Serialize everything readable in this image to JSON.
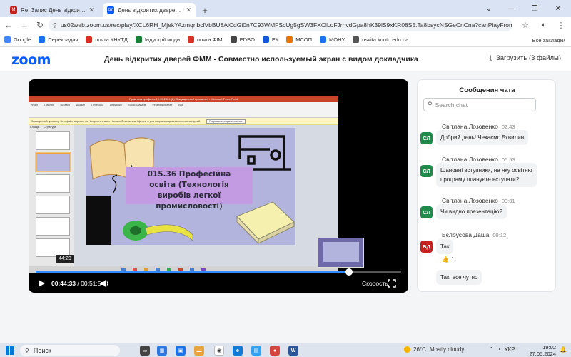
{
  "browser": {
    "tabs": [
      {
        "title": "Re: Запис День відкритих двер",
        "icon_color": "#c5221f",
        "active": false
      },
      {
        "title": "День відкритих дверей ФММ",
        "icon_color": "#0b5cff",
        "active": true
      }
    ],
    "new_tab_symbol": "+",
    "url": "us02web.zoom.us/rec/play/XCL6RH_MjekYAzmqnbclVbBU8AiCdGi0n7C93WMFScUg5gSW3FXClLoFJrnvdGpa8hK39lS9xKR08S5.Ta8bsycNSGeCnCna?canPlayFromShare=true&from...",
    "bookmarks": [
      {
        "label": "Google",
        "icon_color": "#4285f4"
      },
      {
        "label": "Перекладач",
        "icon_color": "#1a73e8"
      },
      {
        "label": "почта КНУТД",
        "icon_color": "#d93025"
      },
      {
        "label": "Індустрії моди",
        "icon_color": "#188038"
      },
      {
        "label": "почта ФІМ",
        "icon_color": "#d93025"
      },
      {
        "label": "EDBO",
        "icon_color": "#444444"
      },
      {
        "label": "ЕК",
        "icon_color": "#1558d6"
      },
      {
        "label": "МСОП",
        "icon_color": "#e37400"
      },
      {
        "label": "МОНУ",
        "icon_color": "#1a73e8"
      },
      {
        "label": "osvita.knutd.edu.ua",
        "icon_color": "#555555"
      }
    ],
    "all_bookmarks": "Все закладки"
  },
  "zoom": {
    "logo": "zoom",
    "recording_title": "День відкритих дверей ФММ - Совместно используемый экран с видом докладчика",
    "download_label": "Загрузить (3 файлы)"
  },
  "slide": {
    "powerpoint_title": "Правнича професія 10.05.2024 (2) [Защищенный просмотр] - Microsoft PowerPoint",
    "ribbon_tabs": [
      "Файл",
      "Главная",
      "Вставка",
      "Дизайн",
      "Переходы",
      "Анимация",
      "Показ слайдов",
      "Рецензирование",
      "Вид"
    ],
    "protected_view_text": "Защищенный просмотр   Этот файл загружен из Интернета и может быть небезопасным. Щелкните для получения дополнительных сведений.",
    "protected_view_button": "Разрешить редактирование",
    "side_tabs": [
      "Слайды",
      "Структура"
    ],
    "title_lines": [
      "015.36 Професійна",
      "освіта (Технологія",
      "виробів легкої промисловості)"
    ]
  },
  "player": {
    "current_time": "00:44:33",
    "separator": " / ",
    "total_time": "00:51:54",
    "progress_fraction": 0.858,
    "hover_time": "44:20",
    "speed_label": "Скорость",
    "accent_color": "#2d8cff"
  },
  "chat": {
    "title": "Сообщения чата",
    "search_placeholder": "Search chat",
    "messages": [
      {
        "initials": "СЛ",
        "avatar_color": "#1f8a4c",
        "sender": "Світлана Лозовенко",
        "time": "02:43",
        "lines": [
          "Добрий день! Чекаємо 5хвилин"
        ]
      },
      {
        "initials": "СЛ",
        "avatar_color": "#1f8a4c",
        "sender": "Світлана Лозовенко",
        "time": "05:53",
        "lines": [
          "Шановні вступники, на яку освітню",
          "програму плануєте вступати?"
        ]
      },
      {
        "initials": "СЛ",
        "avatar_color": "#1f8a4c",
        "sender": "Світлана Лозовенко",
        "time": "09:01",
        "lines": [
          "Чи видно презентацію?"
        ]
      },
      {
        "initials": "БД",
        "avatar_color": "#c5221f",
        "sender": "Бєлоусова Даша",
        "time": "09:12",
        "lines": [
          "Так"
        ],
        "reaction": "👍",
        "reaction_count": "1",
        "followup": "Так, все чутно"
      }
    ]
  },
  "taskbar": {
    "search_label": "Поиск",
    "weather_temp": "26°C",
    "weather_text": "Mostly cloudy",
    "language": "УКР",
    "time": "19:02",
    "date": "27.05.2024"
  }
}
